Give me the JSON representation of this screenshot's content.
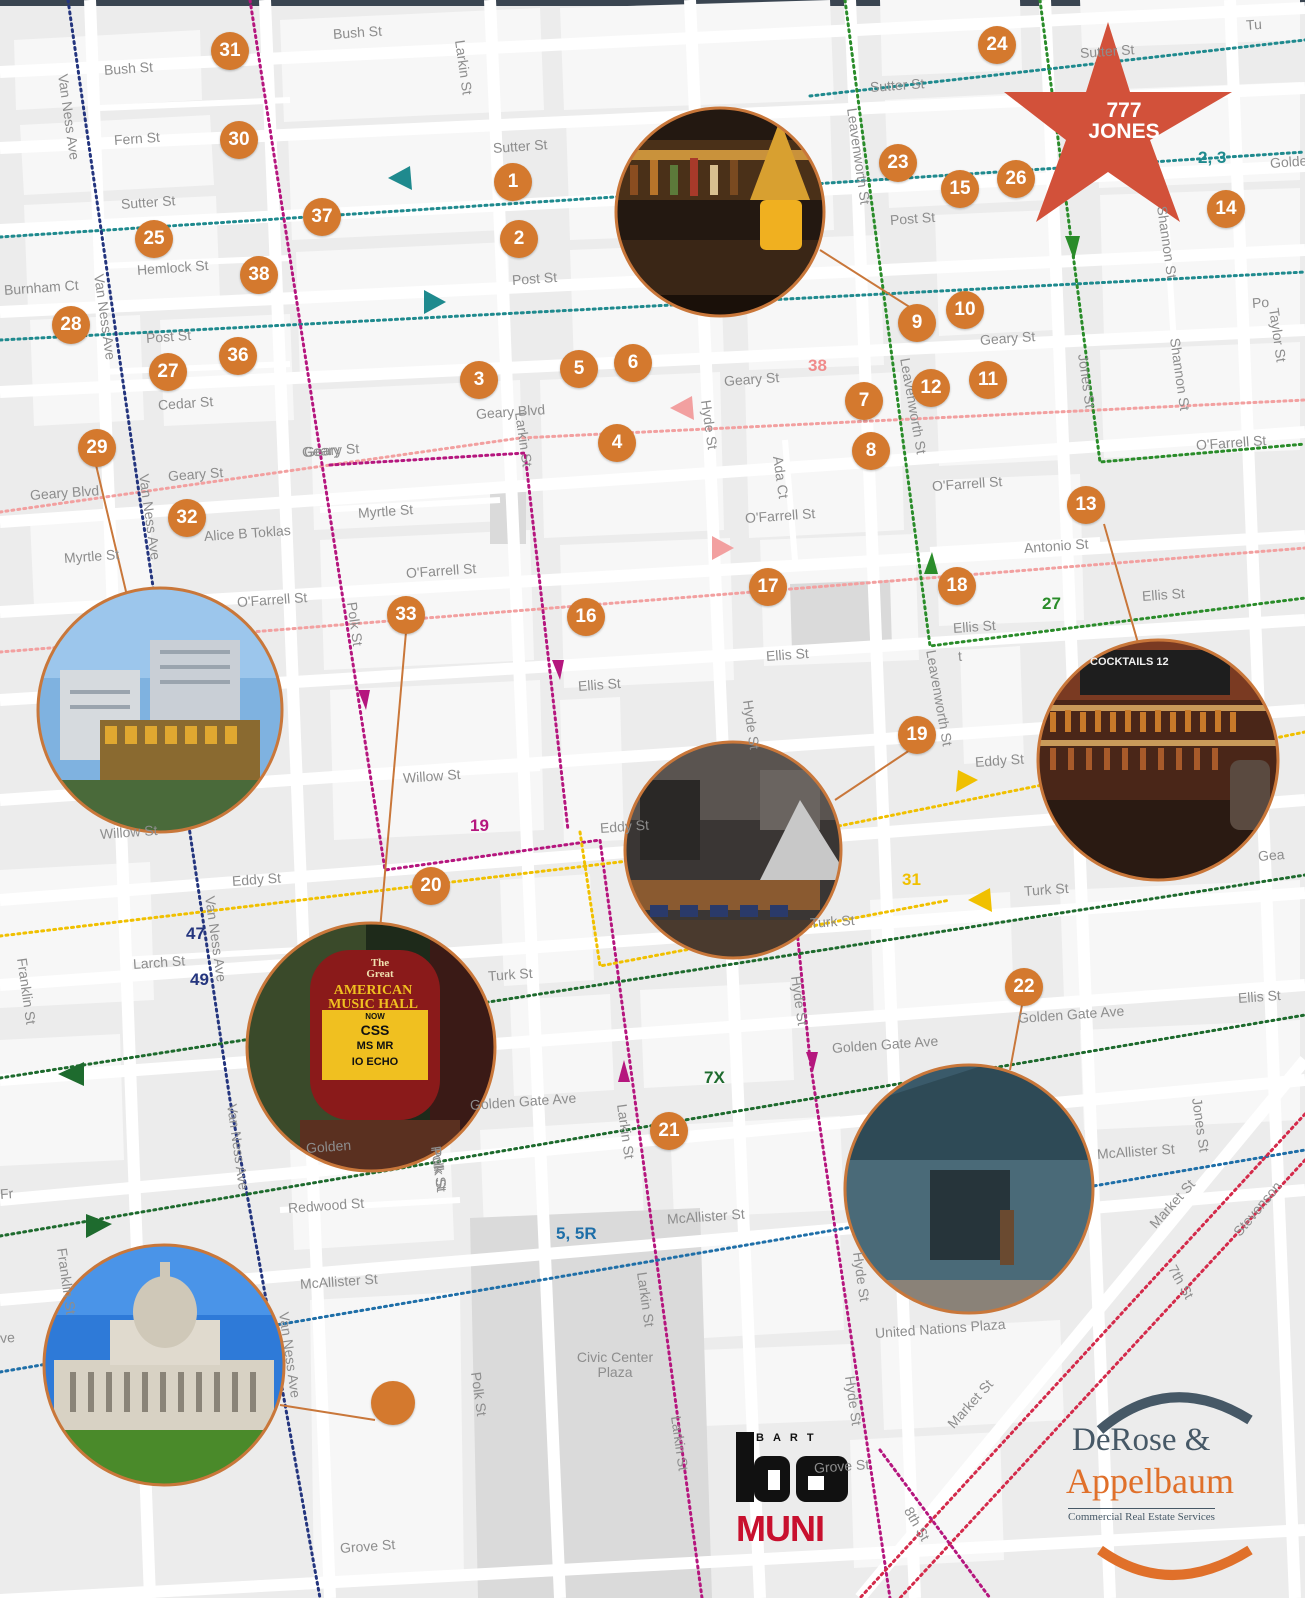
{
  "map": {
    "destination": {
      "label_line1": "777",
      "label_line2": "JONES",
      "color": "#d2513a"
    },
    "pins": [
      "31",
      "30",
      "1",
      "2",
      "37",
      "25",
      "38",
      "28",
      "36",
      "27",
      "3",
      "5",
      "6",
      "4",
      "29",
      "32",
      "33",
      "16",
      "17",
      "23",
      "24",
      "15",
      "26",
      "14",
      "9",
      "10",
      "12",
      "11",
      "7",
      "8",
      "18",
      "13",
      "19",
      "20",
      "21",
      "22"
    ],
    "streets": [
      "Bush St",
      "Bush St",
      "Fern St",
      "Sutter St",
      "Sutter St",
      "Sutter St",
      "Sutter St",
      "Larkin St",
      "Post St",
      "Post St",
      "Post St",
      "Hemlock St",
      "Burnham Ct",
      "Cedar St",
      "Geary St",
      "Geary St",
      "Geary St",
      "Geary Blvd",
      "Geary Blvd",
      "Geary St",
      "Myrtle St",
      "Myrtle St",
      "Alice B Toklas",
      "O'Farrell St",
      "O'Farrell St",
      "O'Farrell St",
      "O'Farrell St",
      "O'Farrell St",
      "Ellis St",
      "Ellis St",
      "Ellis St",
      "Ellis St",
      "Antonio St",
      "Willow St",
      "Eddy St",
      "Eddy St",
      "Larch St",
      "Turk St",
      "Turk St",
      "Golden Gate Ave",
      "Golden Gate Ave",
      "Golden Gate Ave",
      "McAllister St",
      "McAllister St",
      "McAllister St",
      "Redwood St",
      "Grove St",
      "Grove St",
      "United Nations Plaza",
      "Market St",
      "Market St",
      "7th St",
      "8th St",
      "Van Ness Ave",
      "Van Ness Ave",
      "Van Ness Ave",
      "Van Ness Ave",
      "Van Ness Ave",
      "Van Ness Ave",
      "Polk St",
      "Polk St",
      "Polk St",
      "Larkin St",
      "Larkin St",
      "Larkin St",
      "Hyde St",
      "Hyde St",
      "Hyde St",
      "Hyde St",
      "Ada Ct",
      "Leavenworth St",
      "Leavenworth St",
      "Leavenworth St",
      "Jones St",
      "Jones St",
      "Shannon St",
      "Shannon St",
      "Taylor St",
      "Franklin St",
      "Franklin St",
      "Stevenson",
      "Civic Center Plaza",
      "Willow St",
      "Golden",
      "Geary",
      "Polk St",
      "Larkin St",
      "Hyde St",
      "Eddy St",
      "Turk St",
      "Fr",
      "ve",
      "t",
      "Ellis St",
      "Golde",
      "Po",
      "Gea",
      "Tu",
      "Sutt"
    ],
    "route_labels": [
      {
        "text": "2, 3",
        "color": "#1f8a8e"
      },
      {
        "text": "38",
        "color": "#f08b8b"
      },
      {
        "text": "27",
        "color": "#2a8c2a"
      },
      {
        "text": "19",
        "color": "#b5167e"
      },
      {
        "text": "31",
        "color": "#f0c000"
      },
      {
        "text": "47",
        "color": "#24357e"
      },
      {
        "text": "49",
        "color": "#24357e"
      },
      {
        "text": "7X",
        "color": "#1e6b2e"
      },
      {
        "text": "5, 5R",
        "color": "#1f6fa8"
      }
    ],
    "photos": [
      {
        "subject": "cocktail-bar-photo"
      },
      {
        "subject": "hospital-building-photo"
      },
      {
        "subject": "saloon-bar-photo"
      },
      {
        "subject": "whiskey-bar-photo"
      },
      {
        "subject": "music-hall-marquee-photo"
      },
      {
        "subject": "tenderloin-center-photo"
      },
      {
        "subject": "city-hall-photo"
      }
    ],
    "marquee": {
      "line1": "The",
      "line2": "Great",
      "line3": "AMERICAN",
      "line4": "MUSIC HALL",
      "line5": "NOW",
      "line6": "CSS",
      "line7": "MS MR",
      "line8": "IO ECHO"
    },
    "bar_sign": "COCKTAILS 12"
  },
  "logos": {
    "bart": {
      "text": "BART",
      "mark": "ba"
    },
    "muni": {
      "text": "MUNI"
    },
    "derose": {
      "line1": "DeRose &",
      "line2": "Appelbaum",
      "line3": "Commercial Real Estate Services"
    }
  },
  "colors": {
    "pin": "#d4792e",
    "map_bg": "#ececec",
    "block": "#f8f8f8"
  }
}
